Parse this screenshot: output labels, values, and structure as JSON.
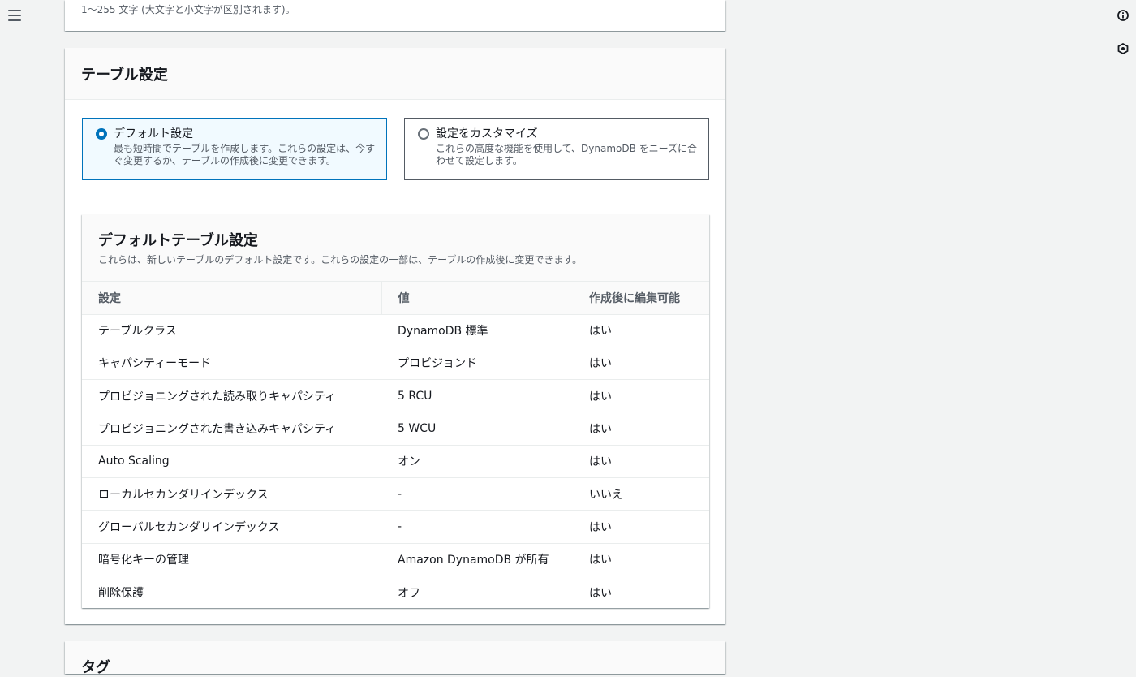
{
  "nav": {
    "menu_icon": "hamburger-icon"
  },
  "right_rail": {
    "icons": [
      "info-icon",
      "feedback-icon"
    ]
  },
  "name_field": {
    "hint": "1～255 文字 (大文字と小文字が区別されます)。"
  },
  "table_settings": {
    "title": "テーブル設定",
    "options": [
      {
        "label": "デフォルト設定",
        "description": "最も短時間でテーブルを作成します。これらの設定は、今すぐ変更するか、テーブルの作成後に変更できます。",
        "selected": true
      },
      {
        "label": "設定をカスタマイズ",
        "description": "これらの高度な機能を使用して、DynamoDB をニーズに合わせて設定します。",
        "selected": false
      }
    ]
  },
  "default_table": {
    "title": "デフォルトテーブル設定",
    "description": "これらは、新しいテーブルのデフォルト設定です。これらの設定の一部は、テーブルの作成後に変更できます。",
    "columns": [
      "設定",
      "値",
      "作成後に編集可能"
    ],
    "rows": [
      [
        "テーブルクラス",
        "DynamoDB 標準",
        "はい"
      ],
      [
        "キャパシティーモード",
        "プロビジョンド",
        "はい"
      ],
      [
        "プロビジョニングされた読み取りキャパシティ",
        "5 RCU",
        "はい"
      ],
      [
        "プロビジョニングされた書き込みキャパシティ",
        "5 WCU",
        "はい"
      ],
      [
        "Auto Scaling",
        "オン",
        "はい"
      ],
      [
        "ローカルセカンダリインデックス",
        "-",
        "いいえ"
      ],
      [
        "グローバルセカンダリインデックス",
        "-",
        "はい"
      ],
      [
        "暗号化キーの管理",
        "Amazon DynamoDB が所有",
        "はい"
      ],
      [
        "削除保護",
        "オフ",
        "はい"
      ]
    ]
  },
  "next_section": {
    "title": "タグ"
  },
  "colors": {
    "accent": "#0073bb",
    "background": "#f2f3f3"
  }
}
